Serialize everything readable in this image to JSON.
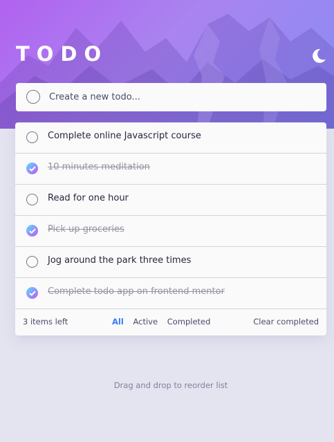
{
  "app": {
    "title": "TODO",
    "theme_icon": "moon-icon"
  },
  "new_todo": {
    "placeholder": "Create a new todo..."
  },
  "todos": [
    {
      "text": "Complete online Javascript course",
      "completed": false
    },
    {
      "text": "10 minutes meditation",
      "completed": true
    },
    {
      "text": "Read for one hour",
      "completed": false
    },
    {
      "text": "Pick up groceries",
      "completed": true
    },
    {
      "text": "Jog around the park three times",
      "completed": false
    },
    {
      "text": "Complete todo app on frontend mentor",
      "completed": true
    }
  ],
  "footer": {
    "items_left": "3 items left",
    "filters": {
      "all": "All",
      "active": "Active",
      "completed": "Completed"
    },
    "active_filter": "All",
    "clear_completed": "Clear completed"
  },
  "hint": "Drag and drop to reorder list",
  "colors": {
    "accent": "#3a7bfd",
    "check_gradient_start": "#57ddff",
    "check_gradient_end": "#c058f3",
    "background": "#e4e4f0"
  }
}
